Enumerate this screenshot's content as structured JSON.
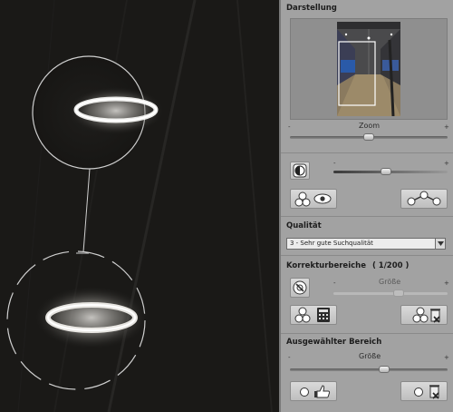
{
  "panel": {
    "darstellung": {
      "title": "Darstellung",
      "zoom_label": "Zoom",
      "minus": "-",
      "plus": "+",
      "zoom_level": 0.5,
      "contrast_level": 0.46
    },
    "qualitaet": {
      "title": "Qualität",
      "selected": "3 - Sehr gute Suchqualität"
    },
    "korrekturbereiche": {
      "title": "Korrekturbereiche",
      "count": "( 1/200 )",
      "size_label": "Größe",
      "minus": "-",
      "plus": "+"
    },
    "ausgewaehlter": {
      "title": "Ausgewählter Bereich",
      "size_label": "Größe",
      "minus": "-",
      "plus": "+",
      "size_level": 0.6
    }
  },
  "icons": {
    "accent": "#2f8fe0"
  }
}
